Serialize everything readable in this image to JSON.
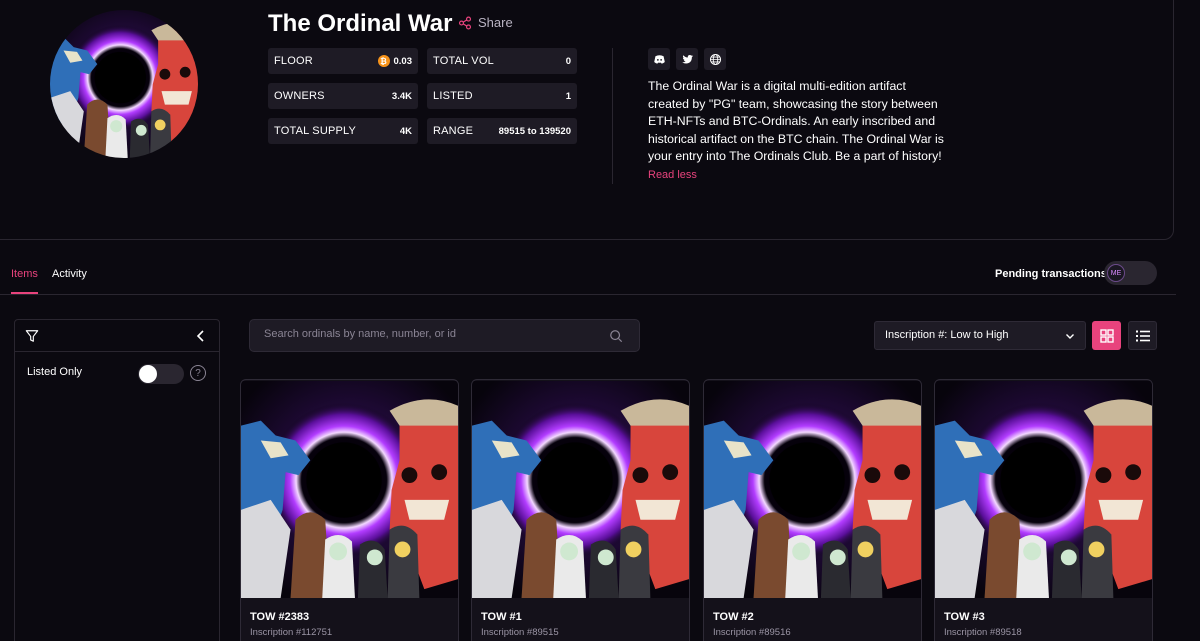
{
  "collection": {
    "title": "The Ordinal War",
    "share_label": "Share",
    "stats": [
      {
        "key": "FLOOR",
        "value": "0.03",
        "btc": true
      },
      {
        "key": "TOTAL VOL",
        "value": "0",
        "btc": false
      },
      {
        "key": "OWNERS",
        "value": "3.4K",
        "btc": false
      },
      {
        "key": "LISTED",
        "value": "1",
        "btc": false
      },
      {
        "key": "TOTAL SUPPLY",
        "value": "4K",
        "btc": false
      },
      {
        "key": "RANGE",
        "value": "89515 to 139520",
        "btc": false
      }
    ],
    "description": "The Ordinal War is a digital multi-edition artifact created by \"PG\" team, showcasing the story between ETH-NFTs and BTC-Ordinals. An early inscribed and historical artifact on the BTC chain. The Ordinal War is your entry into The Ordinals Club. Be a part of history!",
    "read_less": "Read less",
    "socials": [
      "discord-icon",
      "twitter-icon",
      "globe-icon"
    ]
  },
  "tabs": [
    {
      "label": "Items",
      "active": true
    },
    {
      "label": "Activity",
      "active": false
    }
  ],
  "pending": {
    "label": "Pending transactions",
    "badge": "ME"
  },
  "sidebar": {
    "listed_only_label": "Listed Only",
    "help_glyph": "?"
  },
  "search": {
    "placeholder": "Search ordinals by name, number, or id"
  },
  "sort": {
    "selected": "Inscription #: Low to High"
  },
  "accent": "#e8437d",
  "cards": [
    {
      "name": "TOW #2383",
      "inscription": "Inscription #112751"
    },
    {
      "name": "TOW #1",
      "inscription": "Inscription #89515"
    },
    {
      "name": "TOW #2",
      "inscription": "Inscription #89516"
    },
    {
      "name": "TOW #3",
      "inscription": "Inscription #89518"
    }
  ]
}
